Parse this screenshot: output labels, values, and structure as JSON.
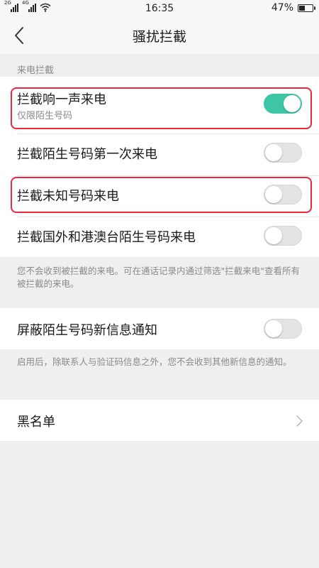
{
  "status_bar": {
    "sim1_network": "2G",
    "sim2_network": "4G",
    "time": "16:35",
    "battery_percent": "47%",
    "battery_level": 0.47
  },
  "nav": {
    "title": "骚扰拦截"
  },
  "section_call": {
    "label": "来电拦截",
    "items": [
      {
        "title": "拦截响一声来电",
        "subtitle": "仅限陌生号码",
        "enabled": true
      },
      {
        "title": "拦截陌生号码第一次来电",
        "enabled": false
      },
      {
        "title": "拦截未知号码来电",
        "enabled": false
      },
      {
        "title": "拦截国外和港澳台陌生号码来电",
        "enabled": false
      }
    ],
    "note": "您不会收到被拦截的来电。可在通话记录内通过筛选\"拦截来电\"查看所有被拦截的来电。"
  },
  "section_sms": {
    "item": {
      "title": "屏蔽陌生号码新信息通知",
      "enabled": false
    },
    "note": "启用后，除联系人与验证码信息之外，您不会收到其他新信息的通知。"
  },
  "blacklist": {
    "title": "黑名单"
  },
  "colors": {
    "toggle_on": "#3ec5a6",
    "toggle_off": "#e3e3e3",
    "highlight": "#e8283c",
    "background": "#efeff0"
  }
}
